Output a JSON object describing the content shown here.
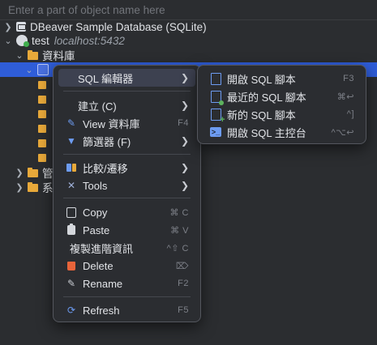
{
  "search": {
    "placeholder": "Enter a part of object name here"
  },
  "tree": {
    "nodes": [
      {
        "label": "DBeaver Sample Database (SQLite)"
      },
      {
        "label": "test",
        "sublabel": "localhost:5432"
      },
      {
        "label": "資料庫"
      },
      {
        "label": ""
      },
      {
        "label": "管"
      },
      {
        "label": "系"
      }
    ]
  },
  "context_menu": {
    "items": [
      {
        "label": "SQL 編輯器",
        "shortcut": "",
        "has_submenu": true,
        "icon": "none"
      },
      {
        "label": "建立 (C)",
        "shortcut": "",
        "has_submenu": true,
        "icon": "none"
      },
      {
        "label": "View 資料庫",
        "shortcut": "F4",
        "has_submenu": false,
        "icon": "pencil-icon"
      },
      {
        "label": "篩選器 (F)",
        "shortcut": "",
        "has_submenu": true,
        "icon": "filter-icon"
      },
      {
        "label": "比較/遷移",
        "shortcut": "",
        "has_submenu": true,
        "icon": "compare-icon"
      },
      {
        "label": "Tools",
        "shortcut": "",
        "has_submenu": true,
        "icon": "tools-icon"
      },
      {
        "label": "Copy",
        "shortcut": "⌘ C",
        "has_submenu": false,
        "icon": "copy-icon"
      },
      {
        "label": "Paste",
        "shortcut": "⌘ V",
        "has_submenu": false,
        "icon": "paste-icon"
      },
      {
        "label": "複製進階資訊",
        "shortcut": "^⇧ C",
        "has_submenu": false,
        "icon": "none"
      },
      {
        "label": "Delete",
        "shortcut": "⌦",
        "has_submenu": false,
        "icon": "delete-icon"
      },
      {
        "label": "Rename",
        "shortcut": "F2",
        "has_submenu": false,
        "icon": "rename-icon"
      },
      {
        "label": "Refresh",
        "shortcut": "F5",
        "has_submenu": false,
        "icon": "refresh-icon"
      }
    ]
  },
  "submenu": {
    "items": [
      {
        "label": "開啟 SQL 腳本",
        "shortcut": "F3",
        "icon": "sql-script-icon"
      },
      {
        "label": "最近的 SQL 腳本",
        "shortcut": "⌘↩",
        "icon": "recent-script-icon"
      },
      {
        "label": "新的 SQL 腳本",
        "shortcut": "^]",
        "icon": "new-script-icon"
      },
      {
        "label": "開啟 SQL 主控台",
        "shortcut": "^⌥↩",
        "icon": "console-icon"
      }
    ]
  }
}
